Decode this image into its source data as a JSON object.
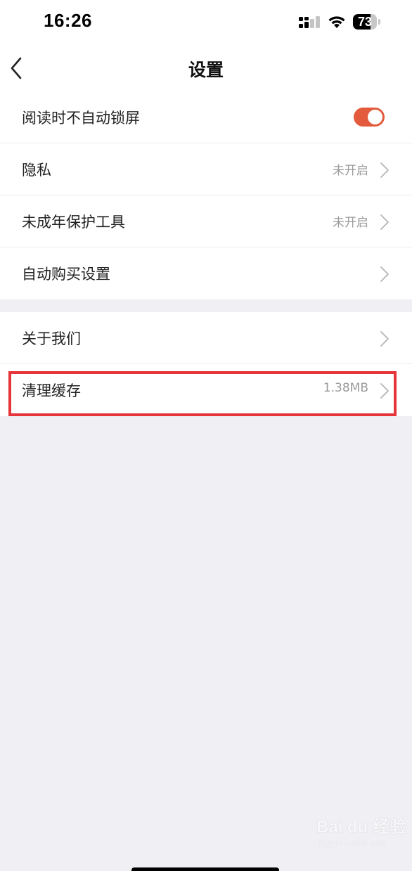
{
  "status_bar": {
    "time": "16:26",
    "battery_level": "73",
    "battery_fraction": 0.73
  },
  "nav": {
    "title": "设置"
  },
  "settings_group_1": [
    {
      "label": "阅读时不自动锁屏",
      "control": "toggle",
      "toggle_on": true
    },
    {
      "label": "隐私",
      "value": "未开启",
      "control": "chevron"
    },
    {
      "label": "未成年保护工具",
      "value": "未开启",
      "control": "chevron"
    },
    {
      "label": "自动购买设置",
      "control": "chevron"
    }
  ],
  "settings_group_2": [
    {
      "label": "关于我们",
      "control": "chevron"
    },
    {
      "label": "清理缓存",
      "value": "1.38MB",
      "control": "chevron",
      "highlighted": true
    }
  ],
  "watermark": {
    "text": "Bai du 经验",
    "sub": "jingyan.baidu.com"
  },
  "colors": {
    "accent": "#e35b3c",
    "highlight_border": "#e5343a",
    "background": "#efeff4",
    "value_text": "#9a9a9a"
  },
  "icons": {
    "back": "chevron-left-icon",
    "row_arrow": "chevron-right-icon",
    "signal": "cellular-signal-icon",
    "wifi": "wifi-icon"
  }
}
